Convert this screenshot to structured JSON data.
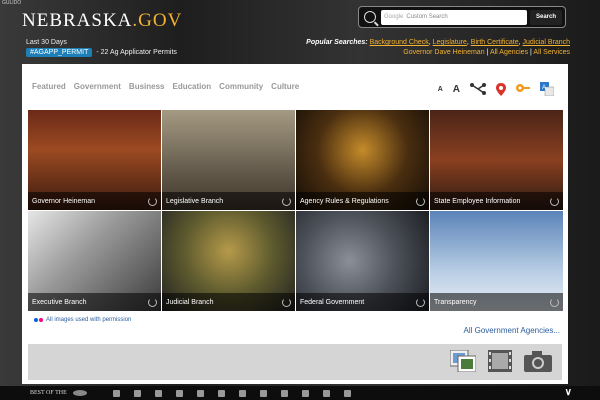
{
  "corner_text": "GULIDO",
  "logo": {
    "main": "NEBRASKA",
    "suffix": ".GOV"
  },
  "trending": {
    "period": "Last 30 Days",
    "hashtag": "#AGAPP_PERMIT",
    "detail": "- 22 Ag Applicator Permits"
  },
  "search": {
    "placeholder": "Custom Search",
    "brand": "Google",
    "button": "Search"
  },
  "popular": {
    "label": "Popular Searches:",
    "links": [
      "Background Check",
      "Legislature",
      "Birth Certificate",
      "Judicial Branch"
    ],
    "row2": [
      "Governor Dave Heineman",
      "All Agencies",
      "All Services"
    ]
  },
  "nav": [
    "Featured",
    "Government",
    "Business",
    "Education",
    "Community",
    "Culture"
  ],
  "tools": {
    "small_a": "A",
    "big_a": "A"
  },
  "tiles": [
    "Governor Heineman",
    "Legislative Branch",
    "Agency Rules & Regulations",
    "State Employee Information",
    "Executive Branch",
    "Judicial Branch",
    "Federal Government",
    "Transparency"
  ],
  "permission": "All images used with permission",
  "agencies_link": "All Government Agencies...",
  "footer": {
    "label": "BEST OF THE"
  },
  "colors": {
    "accent": "#f2b233",
    "link": "#2a5d9f",
    "hashtag": "#1d7fb8"
  }
}
